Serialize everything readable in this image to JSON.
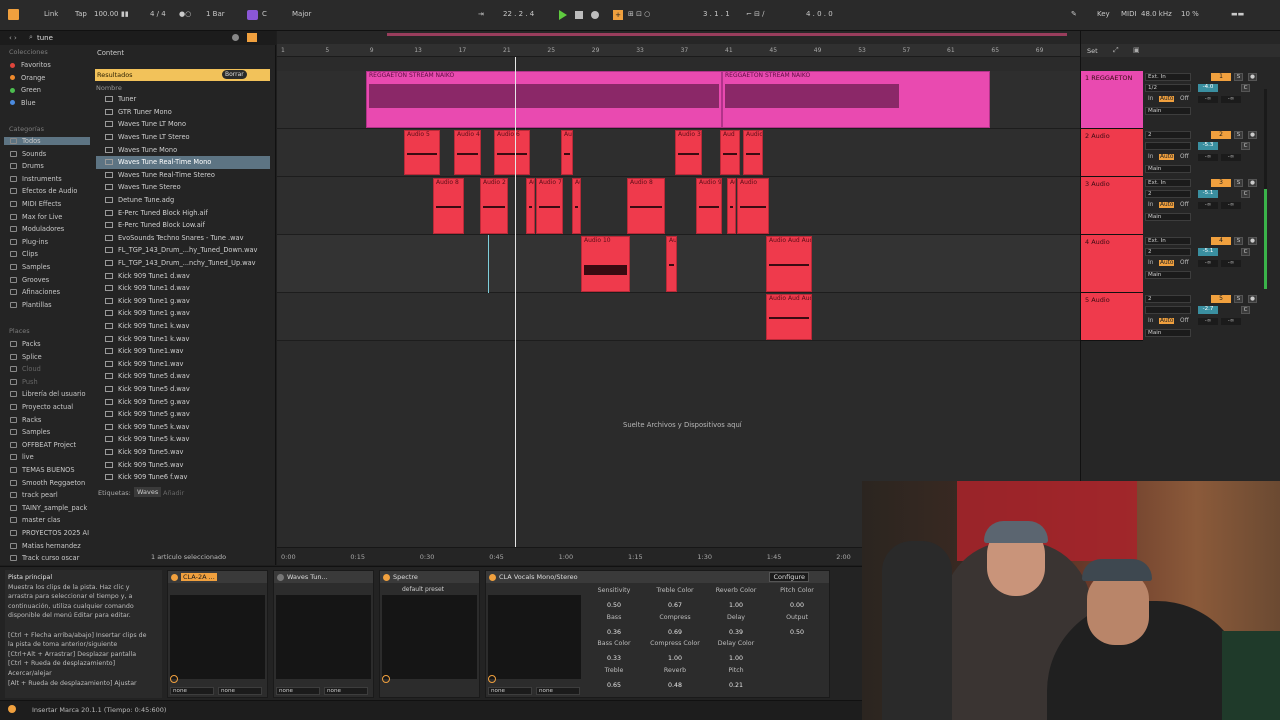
{
  "toolbar": {
    "link": "Link",
    "tap": "Tap",
    "tempo": "100.00",
    "time_sig": "4 / 4",
    "quantize": "1 Bar",
    "key_root": "C",
    "scale": "Major",
    "position": "22 .  2 .  4",
    "loop_start": "3 .  1 .  1",
    "loop_length": "4 .  0 .  0",
    "key_label": "Key",
    "midi_label": "MIDI",
    "sample_rate": "48.0 kHz",
    "cpu": "10 %"
  },
  "browser": {
    "search_value": "tune",
    "content_label": "Content",
    "results_label": "Resultados",
    "clear_label": "Borrar",
    "column_name": "Nombre",
    "collections_heading": "Colecciones",
    "collections": [
      {
        "label": "Favoritos",
        "color": "#e0453b"
      },
      {
        "label": "Orange",
        "color": "#ef8a2c"
      },
      {
        "label": "Green",
        "color": "#4cbd4f"
      },
      {
        "label": "Blue",
        "color": "#4b8be0"
      }
    ],
    "categories_heading": "Categorías",
    "categories": [
      "Todos",
      "Sounds",
      "Drums",
      "Instruments",
      "Efectos de Audio",
      "MIDI Effects",
      "Max for Live",
      "Moduladores",
      "Plug-ins",
      "Clips",
      "Samples",
      "Grooves",
      "Afinaciones",
      "Plantillas"
    ],
    "places_heading": "Places",
    "places": [
      "Packs",
      "Splice",
      "Cloud",
      "Push",
      "Librería del usuario",
      "Proyecto actual",
      "Racks",
      "Samples",
      "OFFBEAT Project",
      "live",
      "TEMAS BUENOS",
      "Smooth Reggaeton",
      "track pearl",
      "TAINY_sample_pack",
      "master clas",
      "PROYECTOS 2025 AI",
      "Matias hernandez",
      "Track curso oscar"
    ],
    "files": [
      "Tuner",
      "GTR Tuner Mono",
      "Waves Tune LT Mono",
      "Waves Tune LT Stereo",
      "Waves Tune Mono",
      "Waves Tune Real-Time Mono",
      "Waves Tune Real-Time Stereo",
      "Waves Tune Stereo",
      "Detune Tune.adg",
      "E-Perc Tuned Block High.aif",
      "E-Perc Tuned Block Low.aif",
      "EvoSounds Techno Snares - Tune .wav",
      "FL_TGP_143_Drum_...hy_Tuned_Down.wav",
      "FL_TGP_143_Drum_...nchy_Tuned_Up.wav",
      "Kick 909 Tune1 d.wav",
      "Kick 909 Tune1 d.wav",
      "Kick 909 Tune1 g.wav",
      "Kick 909 Tune1 g.wav",
      "Kick 909 Tune1 k.wav",
      "Kick 909 Tune1 k.wav",
      "Kick 909 Tune1.wav",
      "Kick 909 Tune1.wav",
      "Kick 909 Tune5 d.wav",
      "Kick 909 Tune5 d.wav",
      "Kick 909 Tune5 g.wav",
      "Kick 909 Tune5 g.wav",
      "Kick 909 Tune5 k.wav",
      "Kick 909 Tune5 k.wav",
      "Kick 909 Tune5.wav",
      "Kick 909 Tune5.wav",
      "Kick 909 Tune6 f.wav"
    ],
    "tags_label": "Etiquetas:",
    "tag_waves": "Waves",
    "tag_add": "Añadir",
    "selection_status": "1 artículo seleccionado"
  },
  "arrangement": {
    "bar_numbers": [
      "1",
      "5",
      "9",
      "13",
      "17",
      "21",
      "25",
      "29",
      "33",
      "37",
      "41",
      "45",
      "49",
      "53",
      "57",
      "61",
      "65",
      "69"
    ],
    "time_labels": [
      "0:00",
      "0:15",
      "0:30",
      "0:45",
      "1:00",
      "1:15",
      "1:30",
      "1:45",
      "2:00"
    ],
    "drop_hint": "Suelte Archivos y Dispositivos aquí",
    "set_label": "Set",
    "clip_main_1": "REGGAETON STREAM NAIKO",
    "clip_main_2": "REGGAETON STREAM NAIKO",
    "track2_clips": [
      "Audio 5",
      "Audio 4",
      "Audio 6",
      "Aud",
      "Audio 3",
      "Aud",
      "Audio"
    ],
    "track3_clips": [
      "Audio 8",
      "Audio 2",
      "Au",
      "Audio 7",
      "Au",
      "Audio 8",
      "Audio 9",
      "Au",
      "Audio"
    ],
    "track4_clips": [
      "Audio 10",
      "Au",
      "Audio Aud Aud"
    ],
    "track5_clips": [
      "Audio Aud Aud"
    ]
  },
  "tracks": [
    {
      "name": "1 REGGAETON",
      "num": "1",
      "input": "Ext. In",
      "channel": "1/2",
      "vol": "-4.0",
      "out": "Main",
      "color": "#e94ab0"
    },
    {
      "name": "2 Audio",
      "num": "2",
      "input": "2",
      "channel": "",
      "vol": "-5.3",
      "out": "Main",
      "color": "#ef3a4c"
    },
    {
      "name": "3 Audio",
      "num": "3",
      "input": "Ext. In",
      "channel": "2",
      "vol": "-5.1",
      "out": "Main",
      "color": "#ef3a4c"
    },
    {
      "name": "4 Audio",
      "num": "4",
      "input": "Ext. In",
      "channel": "2",
      "vol": "-5.1",
      "out": "Main",
      "color": "#ef3a4c"
    },
    {
      "name": "5 Audio",
      "num": "5",
      "input": "2",
      "channel": "",
      "vol": "-2.7",
      "out": "Main",
      "color": "#ef3a4c"
    }
  ],
  "mixer_labels": {
    "in": "In",
    "auto": "Auto",
    "off": "Off",
    "s": "S",
    "c": "C",
    "inf": "-∞"
  },
  "info": {
    "title": "Pista principal",
    "lines": [
      "Muestra los clips de la pista. Haz clic y",
      "arrastra para seleccionar el tiempo y, a",
      "continuación, utiliza cualquier comando",
      "disponible del menú Editar para editar.",
      "",
      "[Ctrl + Flecha arriba/abajo] Insertar clips de",
      "la pista de toma anterior/siguiente",
      "[Ctrl+Alt + Arrastrar] Desplazar pantalla",
      "[Ctrl + Rueda de desplazamiento]",
      "Acercar/alejar",
      "[Alt + Rueda de desplazamiento] Ajustar"
    ]
  },
  "devices": {
    "d1": "CLA-2A ...",
    "d2": "Waves Tun...",
    "d3": "Spectre",
    "d3_preset": "default preset",
    "d4": "CLA Vocals Mono/Stereo",
    "configure": "Configure",
    "none": "none",
    "params": [
      {
        "label": "Sensitivity",
        "value": "0.50"
      },
      {
        "label": "Treble Color",
        "value": "0.67"
      },
      {
        "label": "Reverb Color",
        "value": "1.00"
      },
      {
        "label": "Pitch Color",
        "value": "0.00"
      },
      {
        "label": "Bass",
        "value": "0.36"
      },
      {
        "label": "Compress",
        "value": "0.69"
      },
      {
        "label": "Delay",
        "value": "0.39"
      },
      {
        "label": "Output",
        "value": "0.50"
      },
      {
        "label": "Bass Color",
        "value": "0.33"
      },
      {
        "label": "Compress Color",
        "value": "1.00"
      },
      {
        "label": "Delay Color",
        "value": "1.00"
      },
      {
        "label": "Treble",
        "value": "0.65"
      },
      {
        "label": "Reverb",
        "value": "0.48"
      },
      {
        "label": "Pitch",
        "value": "0.21"
      }
    ]
  },
  "status": {
    "text": "Insertar Marca 20.1.1 (Tiempo: 0:45:600)"
  }
}
